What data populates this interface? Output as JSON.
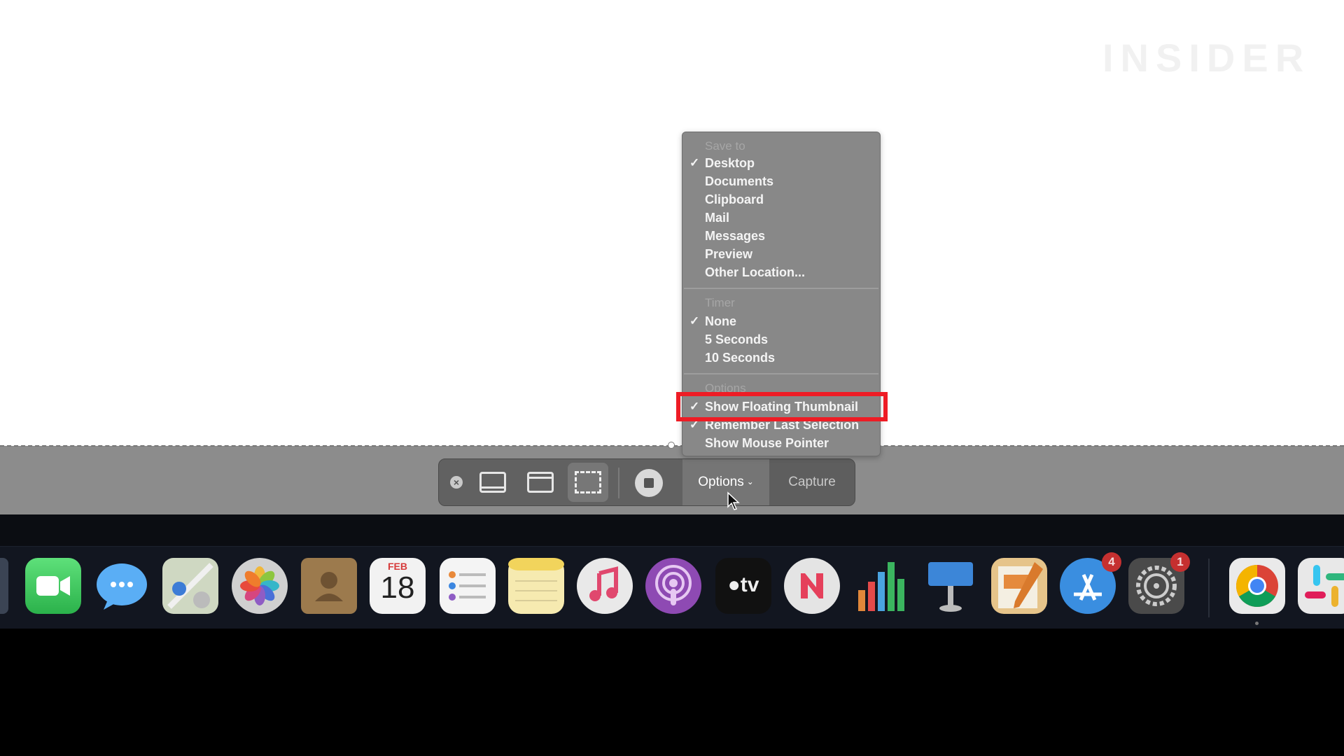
{
  "watermark": "INSIDER",
  "toolbar": {
    "close_icon": "close-icon",
    "capture_entire_screen_icon": "screen-icon",
    "capture_window_icon": "window-icon",
    "capture_selection_icon": "selection-icon",
    "record_icon": "record-icon",
    "options_label": "Options",
    "capture_label": "Capture"
  },
  "menu": {
    "save_to": {
      "header": "Save to",
      "items": [
        {
          "label": "Desktop",
          "checked": true
        },
        {
          "label": "Documents",
          "checked": false
        },
        {
          "label": "Clipboard",
          "checked": false
        },
        {
          "label": "Mail",
          "checked": false
        },
        {
          "label": "Messages",
          "checked": false
        },
        {
          "label": "Preview",
          "checked": false
        },
        {
          "label": "Other Location...",
          "checked": false
        }
      ]
    },
    "timer": {
      "header": "Timer",
      "items": [
        {
          "label": "None",
          "checked": true
        },
        {
          "label": "5 Seconds",
          "checked": false
        },
        {
          "label": "10 Seconds",
          "checked": false
        }
      ]
    },
    "options": {
      "header": "Options",
      "items": [
        {
          "label": "Show Floating Thumbnail",
          "checked": true,
          "highlighted": true
        },
        {
          "label": "Remember Last Selection",
          "checked": true
        },
        {
          "label": "Show Mouse Pointer",
          "checked": false
        }
      ]
    }
  },
  "dock": {
    "apps": [
      {
        "name": "FaceTime",
        "icon": "facetime-icon"
      },
      {
        "name": "Messages",
        "icon": "messages-icon"
      },
      {
        "name": "Maps",
        "icon": "maps-icon"
      },
      {
        "name": "Photos",
        "icon": "photos-icon"
      },
      {
        "name": "Contacts",
        "icon": "contacts-icon"
      },
      {
        "name": "Calendar",
        "icon": "calendar-icon",
        "month": "FEB",
        "day": "18"
      },
      {
        "name": "Reminders",
        "icon": "reminders-icon"
      },
      {
        "name": "Notes",
        "icon": "notes-icon"
      },
      {
        "name": "Music",
        "icon": "music-icon"
      },
      {
        "name": "Podcasts",
        "icon": "podcasts-icon"
      },
      {
        "name": "TV",
        "icon": "tv-icon",
        "text": "tv"
      },
      {
        "name": "News",
        "icon": "news-icon"
      },
      {
        "name": "Numbers",
        "icon": "numbers-icon"
      },
      {
        "name": "Keynote",
        "icon": "keynote-icon"
      },
      {
        "name": "Pages",
        "icon": "pages-icon"
      },
      {
        "name": "App Store",
        "icon": "app-store-icon",
        "badge": "4"
      },
      {
        "name": "System Preferences",
        "icon": "system-preferences-icon",
        "badge": "1"
      },
      {
        "name": "Chrome",
        "icon": "chrome-icon"
      },
      {
        "name": "Slack",
        "icon": "slack-icon"
      }
    ]
  },
  "colors": {
    "highlight_border": "#ee1c25",
    "menu_background": "#888888",
    "toolbar_background": "#616161",
    "badge": "#c53030"
  }
}
